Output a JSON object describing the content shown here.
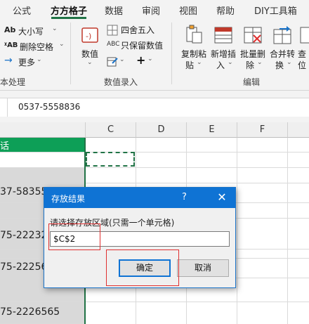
{
  "ribbon_tabs": [
    "公式",
    "方方格子",
    "数据",
    "审阅",
    "视图",
    "帮助",
    "DIY工具箱"
  ],
  "active_tab": "方方格子",
  "text_group": {
    "case_label": "大小写",
    "delete_space_label": "删除空格",
    "more_label": "更多",
    "group_label": "本处理"
  },
  "number_group": {
    "value_label": "数值",
    "round_label": "四舍五入",
    "keep_numeric_label": "只保留数值",
    "group_label": "数值录入"
  },
  "edit_group": {
    "copy_paste_line1": "复制粘",
    "copy_paste_line2": "贴",
    "new_insert_line1": "新增插",
    "new_insert_line2": "入",
    "batch_delete_line1": "批量删",
    "batch_delete_line2": "除",
    "merge_convert_line1": "合并转",
    "merge_convert_line2": "换",
    "find_line1": "查",
    "find_line2": "位",
    "group_label": "编辑"
  },
  "formula_bar": {
    "value": "0537-5558836"
  },
  "columns": [
    "C",
    "D",
    "E",
    "F"
  ],
  "column_b_header": "话",
  "cells": {
    "row3": "37-58355",
    "row5": "75-22232",
    "row7": "75-22256",
    "row9": "75-2226565"
  },
  "dialog": {
    "title": "存放结果",
    "help": "?",
    "close": "✕",
    "prompt": "请选择存放区域(只需一个单元格)",
    "input_value": "$C$2",
    "ok_label": "确定",
    "cancel_label": "取消"
  },
  "colors": {
    "accent": "#217346",
    "dialog_title": "#0f73d4",
    "highlight_box": "#e03030",
    "header_fill": "#0d9f57"
  }
}
